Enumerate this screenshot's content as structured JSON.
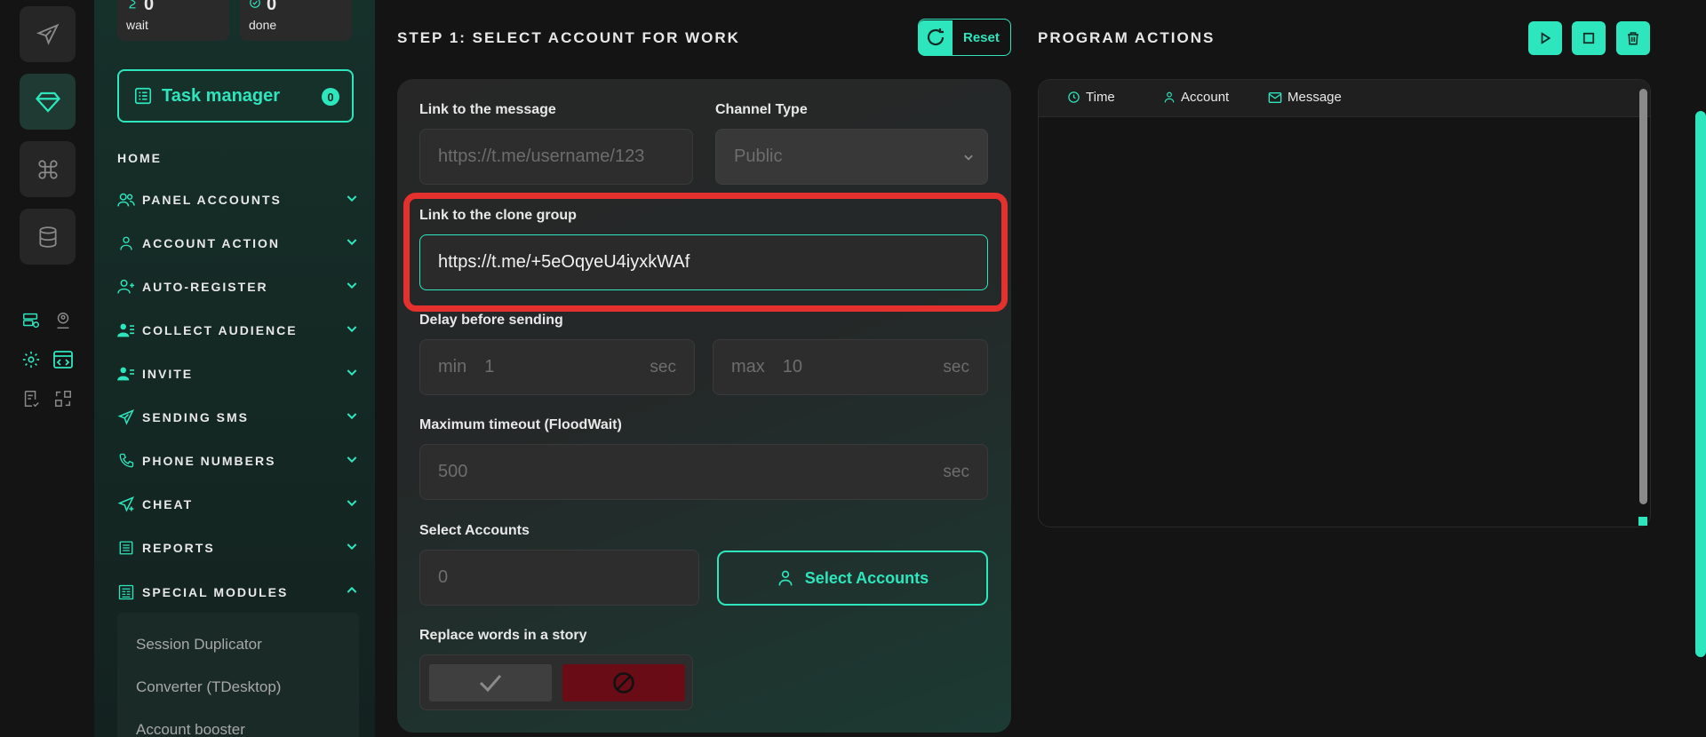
{
  "stats": [
    {
      "value": "0",
      "label": "wait"
    },
    {
      "value": "0",
      "label": "done"
    }
  ],
  "task_manager": {
    "label": "Task manager",
    "count": "0"
  },
  "nav": {
    "home": "HOME",
    "items": [
      {
        "label": "PANEL ACCOUNTS",
        "icon": "users-icon",
        "expanded": false
      },
      {
        "label": "ACCOUNT ACTION",
        "icon": "user-icon",
        "expanded": false
      },
      {
        "label": "AUTO-REGISTER",
        "icon": "user-plus-icon",
        "expanded": false
      },
      {
        "label": "COLLECT AUDIENCE",
        "icon": "user-list-icon",
        "expanded": false
      },
      {
        "label": "INVITE",
        "icon": "user-invite-icon",
        "expanded": false
      },
      {
        "label": "SENDING SMS",
        "icon": "paper-plane-icon",
        "expanded": false
      },
      {
        "label": "PHONE NUMBERS",
        "icon": "phone-icon",
        "expanded": false
      },
      {
        "label": "CHEAT",
        "icon": "send-cheat-icon",
        "expanded": false
      },
      {
        "label": "REPORTS",
        "icon": "report-icon",
        "expanded": false
      },
      {
        "label": "SPECIAL MODULES",
        "icon": "modules-icon",
        "expanded": true
      }
    ],
    "submenu": [
      "Session Duplicator",
      "Converter (TDesktop)",
      "Account booster"
    ]
  },
  "step": {
    "title": "STEP 1: SELECT ACCOUNT FOR WORK",
    "reset_label": "Reset"
  },
  "form": {
    "message_link": {
      "label": "Link to the message",
      "placeholder": "https://t.me/username/123"
    },
    "channel_type": {
      "label": "Channel Type",
      "value": "Public"
    },
    "clone_group": {
      "label": "Link to the clone group",
      "value": "https://t.me/+5eOqyeU4iyxkWAf"
    },
    "delay": {
      "label": "Delay before sending",
      "min_prefix": "min",
      "min_value": "1",
      "max_prefix": "max",
      "max_value": "10",
      "unit": "sec"
    },
    "timeout": {
      "label": "Maximum timeout (FloodWait)",
      "value": "500",
      "unit": "sec"
    },
    "accounts": {
      "label": "Select Accounts",
      "value": "0",
      "button": "Select Accounts"
    },
    "replace_words": {
      "label": "Replace words in a story"
    }
  },
  "actions": {
    "title": "PROGRAM ACTIONS",
    "columns": [
      "Time",
      "Account",
      "Message"
    ]
  },
  "colors": {
    "accent": "#2ee6bd",
    "highlight": "#e5312d",
    "danger": "#6a0c16"
  }
}
